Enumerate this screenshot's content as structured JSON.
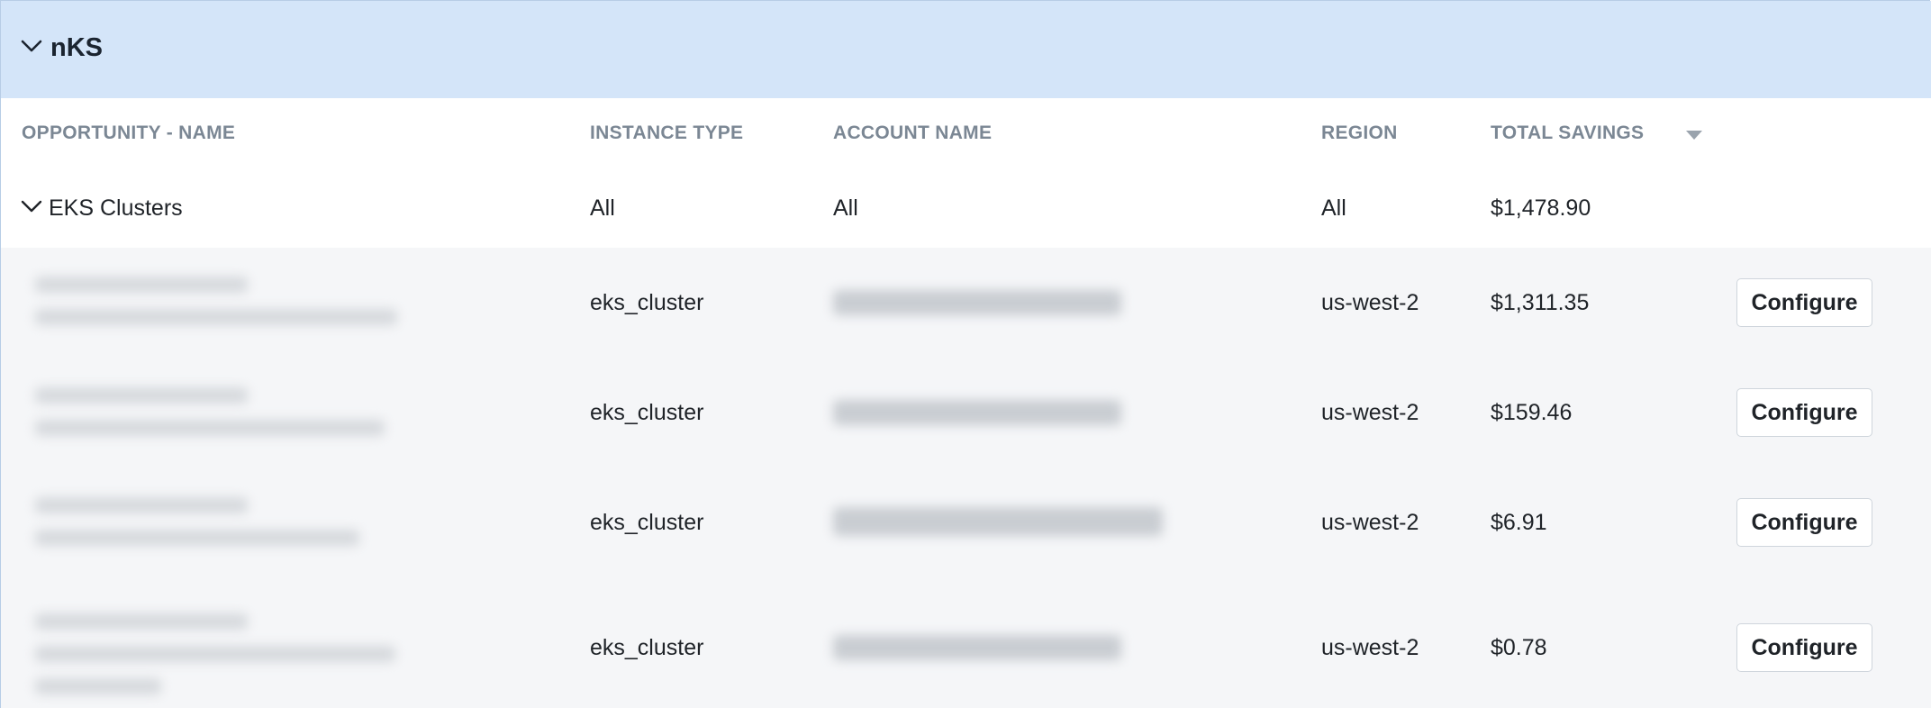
{
  "group": {
    "title": "nKS"
  },
  "columns": {
    "name": "OPPORTUNITY - NAME",
    "instance_type": "INSTANCE TYPE",
    "account_name": "ACCOUNT NAME",
    "region": "REGION",
    "total_savings": "TOTAL SAVINGS"
  },
  "summary": {
    "name": "EKS Clusters",
    "instance_type": "All",
    "account_name": "All",
    "region": "All",
    "total_savings": "$1,478.90"
  },
  "rows": [
    {
      "instance_type": "eks_cluster",
      "region": "us-west-2",
      "total_savings": "$1,311.35",
      "action": "Configure"
    },
    {
      "instance_type": "eks_cluster",
      "region": "us-west-2",
      "total_savings": "$159.46",
      "action": "Configure"
    },
    {
      "instance_type": "eks_cluster",
      "region": "us-west-2",
      "total_savings": "$6.91",
      "action": "Configure"
    },
    {
      "instance_type": "eks_cluster",
      "region": "us-west-2",
      "total_savings": "$0.78",
      "action": "Configure"
    }
  ],
  "icons": {
    "group_toggle": "chevron-down-icon",
    "summary_toggle": "chevron-down-icon",
    "sort": "sort-desc-icon"
  },
  "colors": {
    "group_header_bg": "#d4e5f9",
    "row_bg": "#f5f6f8",
    "header_text": "#7b8794"
  }
}
